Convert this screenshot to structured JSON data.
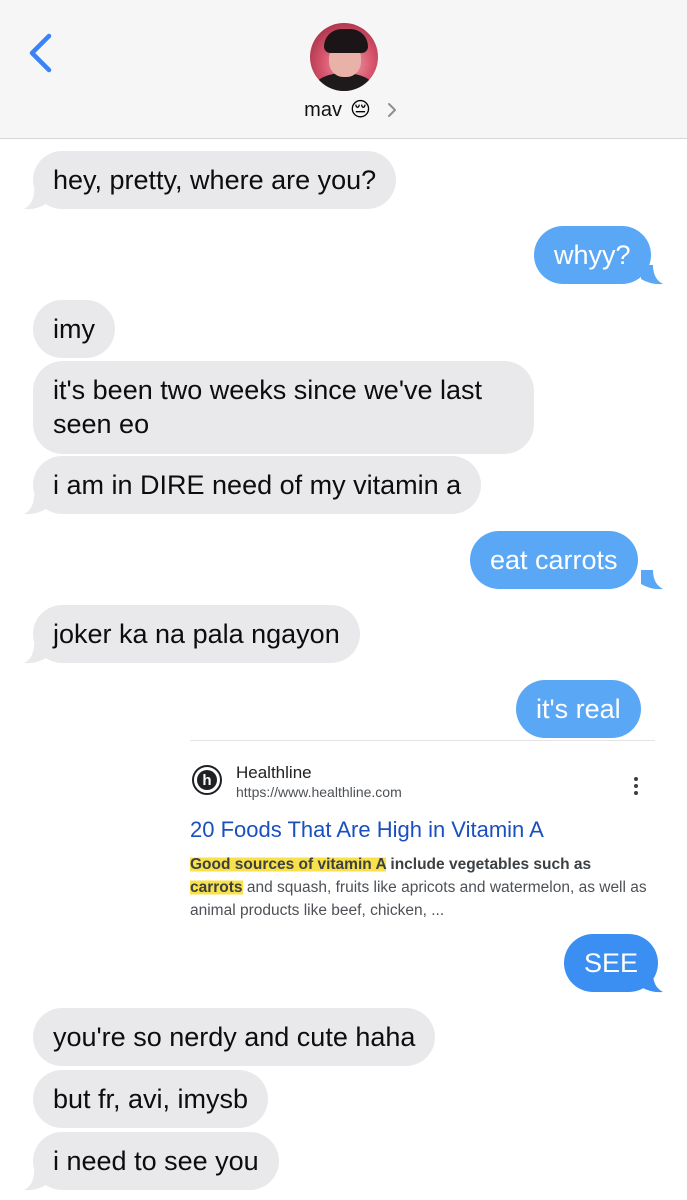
{
  "header": {
    "contact_name": "mav",
    "contact_emoji": "😔"
  },
  "messages": [
    {
      "side": "in",
      "text": "hey, pretty, where are you?"
    },
    {
      "side": "out",
      "text": "whyy?"
    },
    {
      "side": "in",
      "text": "imy"
    },
    {
      "side": "in",
      "line1": "it's been two weeks since we've last",
      "line2": "seen eo"
    },
    {
      "side": "in",
      "text": "i am in DIRE need of my vitamin a"
    },
    {
      "side": "out",
      "text": "eat carrots"
    },
    {
      "side": "in",
      "text": "joker ka na pala ngayon"
    },
    {
      "side": "out",
      "text": "it's real"
    },
    {
      "side": "out",
      "text": "SEE"
    },
    {
      "side": "in",
      "text": "you're so nerdy and cute haha"
    },
    {
      "side": "in",
      "text": "but fr, avi, imysb"
    },
    {
      "side": "in",
      "text": "i need to see you"
    }
  ],
  "search_card": {
    "site": "Healthline",
    "url": "https://www.healthline.com",
    "title": "20 Foods That Are High in Vitamin A",
    "snippet_hl1": "Good sources of vitamin A",
    "snippet_mid1": " include vegetables such as",
    "snippet_hl2": "carrots",
    "snippet_rest": " and squash, fruits like apricots and watermelon, as well as animal products like beef, chicken, ..."
  },
  "colors": {
    "incoming_bubble": "#e9e9eb",
    "outgoing_bubble": "#5aa8f5",
    "accent_blue": "#3b8ff2",
    "link_blue": "#1a4fbf",
    "highlight": "#f8e14a"
  },
  "icons": {
    "back": "chevron-left-icon",
    "details": "chevron-right-icon",
    "menu": "more-vert-icon"
  }
}
